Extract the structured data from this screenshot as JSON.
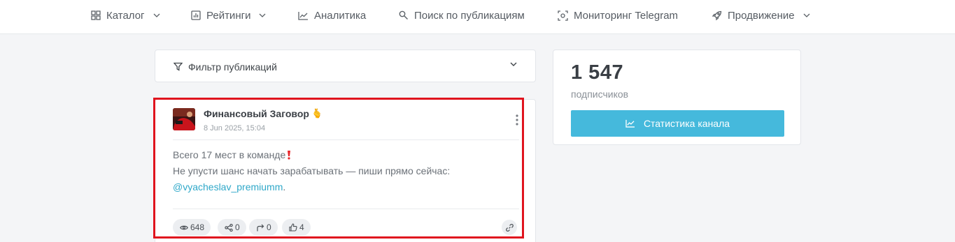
{
  "nav": {
    "items": [
      {
        "label": "Каталог",
        "icon": "grid-icon",
        "has_dropdown": true
      },
      {
        "label": "Рейтинги",
        "icon": "bar-chart-icon",
        "has_dropdown": true
      },
      {
        "label": "Аналитика",
        "icon": "line-chart-icon",
        "has_dropdown": false
      },
      {
        "label": "Поиск по публикациям",
        "icon": "search-icon",
        "has_dropdown": false
      },
      {
        "label": "Мониторинг Telegram",
        "icon": "monitor-icon",
        "has_dropdown": false
      },
      {
        "label": "Продвижение",
        "icon": "rocket-icon",
        "has_dropdown": true
      }
    ]
  },
  "filter": {
    "label": "Фильтр публикаций",
    "icon": "filter-icon"
  },
  "stats": {
    "subscribers_count": "1 547",
    "subscribers_label": "подписчиков",
    "button_label": "Статистика канала",
    "button_color": "#45b9dc"
  },
  "post": {
    "channel_name": "Финансовый Заговор",
    "channel_emoji": "🫰",
    "date": "8 Jun 2025, 15:04",
    "text_line1": "Всего 17 мест в команде",
    "text_line2": "Не упусти шанс начать зарабатывать — пиши прямо сейчас:",
    "link": "@vyacheslav_premiumm",
    "link_suffix": ".",
    "link_color": "#2fa8c9",
    "stats": {
      "views": "648",
      "shares": "0",
      "forwards": "0",
      "likes": "4"
    }
  },
  "highlight_color": "#e0141e"
}
